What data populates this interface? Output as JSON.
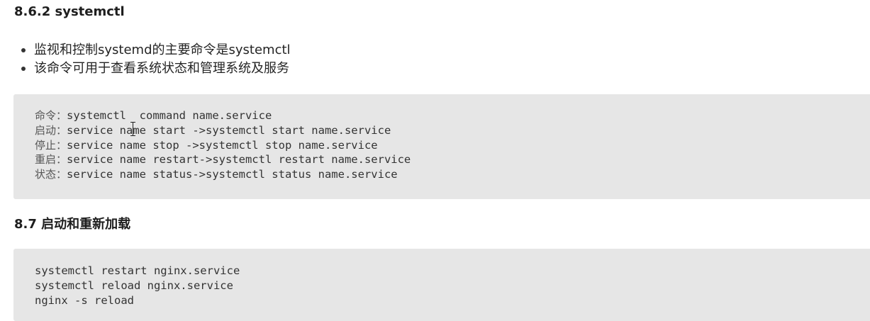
{
  "section_1": {
    "heading": "8.6.2 systemctl",
    "bullets": [
      "监视和控制systemd的主要命令是systemctl",
      "该命令可用于查看系统状态和管理系统及服务"
    ],
    "code_lines": [
      {
        "label": "命令：",
        "code": "systemctl  command name.service"
      },
      {
        "label": "启动：",
        "code": "service name start ->systemctl start name.service"
      },
      {
        "label": "停止：",
        "code": "service name stop ->systemctl stop name.service"
      },
      {
        "label": "重启：",
        "code": "service name restart->systemctl restart name.service"
      },
      {
        "label": "状态：",
        "code": "service name status->systemctl status name.service"
      }
    ]
  },
  "section_2": {
    "heading": "8.7 启动和重新加载",
    "code_lines": [
      "systemctl restart nginx.service",
      "systemctl reload nginx.service",
      "nginx -s reload"
    ]
  },
  "cursor": {
    "icon": "text-cursor-icon"
  }
}
